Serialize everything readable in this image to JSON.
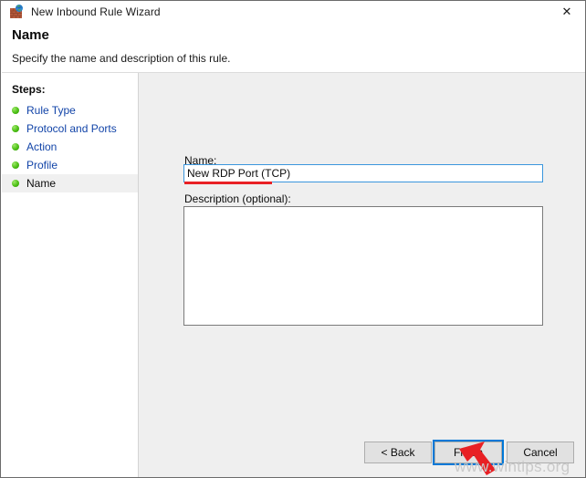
{
  "window": {
    "title": "New Inbound Rule Wizard",
    "icon": "firewall-globe-icon",
    "close_label": "✕"
  },
  "header": {
    "title": "Name",
    "subtitle": "Specify the name and description of this rule."
  },
  "sidebar": {
    "heading": "Steps:",
    "items": [
      {
        "label": "Rule Type",
        "state": "done"
      },
      {
        "label": "Protocol and Ports",
        "state": "done"
      },
      {
        "label": "Action",
        "state": "done"
      },
      {
        "label": "Profile",
        "state": "done"
      },
      {
        "label": "Name",
        "state": "current"
      }
    ]
  },
  "form": {
    "name_label": "Name:",
    "name_value": "New RDP Port (TCP)",
    "name_placeholder": "",
    "description_label": "Description (optional):",
    "description_value": "",
    "description_placeholder": ""
  },
  "footer": {
    "back_label": "< Back",
    "finish_label": "Finish",
    "cancel_label": "Cancel"
  },
  "annotations": {
    "watermark": "www.wintips.org",
    "cursor": "red-arrow-cursor",
    "underline": "red-underline-highlight"
  },
  "colors": {
    "accent_blue": "#0078d7",
    "focus_border": "#3a96dd",
    "annotation_red": "#e82024",
    "step_link": "#1244a8",
    "step_bullet_green": "#4cc015",
    "panel_gray": "#efefef",
    "watermark_gray": "#c9c9c9"
  }
}
